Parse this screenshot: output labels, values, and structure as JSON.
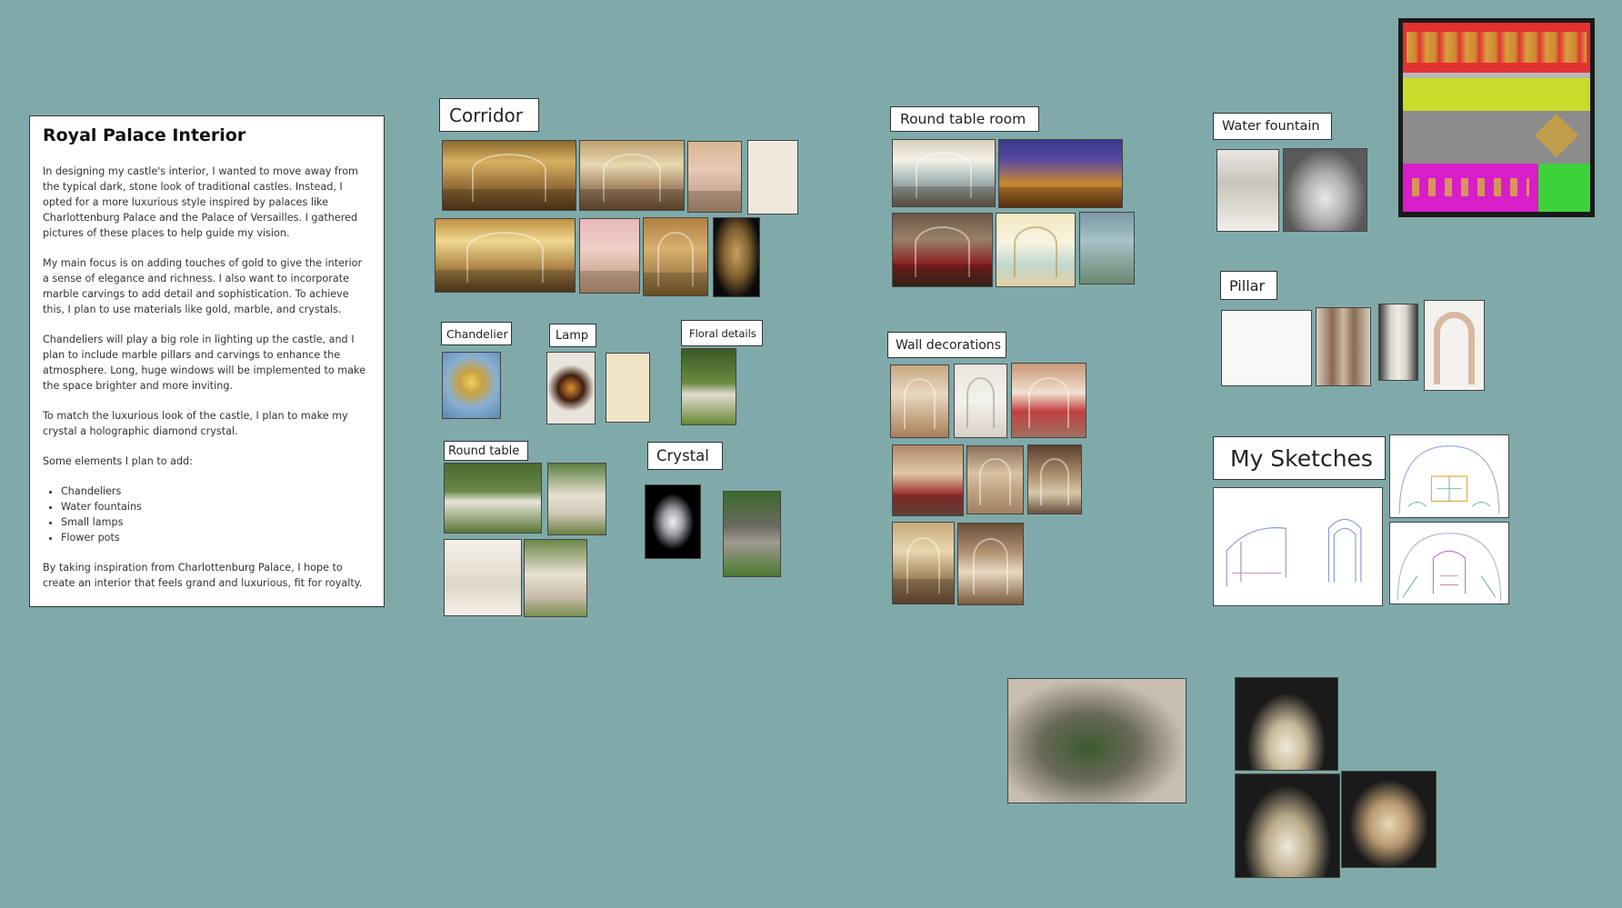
{
  "note": {
    "title": "Royal Palace Interior",
    "paragraphs": [
      "In designing my castle's interior, I wanted to move away from the typical dark, stone look of traditional castles. Instead, I opted for a more luxurious style inspired by palaces like Charlottenburg Palace and the Palace of Versailles. I gathered pictures of these places to help guide my vision.",
      "My main focus is on adding touches of gold to give the interior a sense of elegance and richness. I also want to incorporate marble carvings to add detail and sophistication. To achieve this, I plan to use materials like gold, marble, and crystals.",
      "Chandeliers will play a big role in lighting up the castle, and I plan to include marble pillars and carvings to enhance the atmosphere. Long, huge windows will be implemented to make the space brighter and more inviting.",
      "To match the luxurious look of the castle, I plan to make my crystal a holographic diamond crystal.",
      "Some elements I plan to add:"
    ],
    "bullets": [
      "Chandeliers",
      "Water fountains",
      "Small lamps",
      "Flower pots"
    ],
    "closing": "By taking inspiration from Charlottenburg Palace, I hope to create an interior that feels grand and luxurious, fit for royalty."
  },
  "labels": {
    "corridor": "Corridor",
    "chandelier": "Chandelier",
    "lamp": "Lamp",
    "floral_details": "Floral details",
    "round_table": "Round table",
    "crystal": "Crystal",
    "round_table_room": "Round table room",
    "wall_decorations": "Wall decorations",
    "water_fountain": "Water fountain",
    "pillar": "Pillar",
    "my_sketches": "My Sketches"
  },
  "colors": {
    "board_background": "#80aaaa",
    "swatch_red": "#e23232",
    "swatch_lime": "#c8dc2a",
    "swatch_gray": "#8c8c8c",
    "swatch_magenta": "#d81ec8",
    "swatch_green": "#3ed23a",
    "gold": "#c8a040"
  }
}
